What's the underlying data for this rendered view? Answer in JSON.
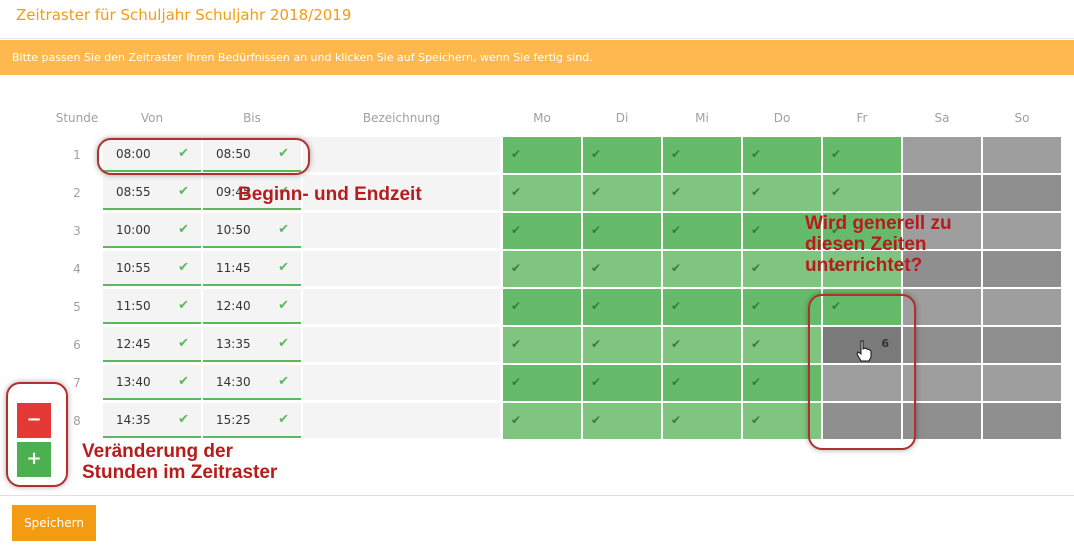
{
  "header": {
    "title": "Zeitraster für Schuljahr Schuljahr 2018/2019"
  },
  "notice": {
    "text": "Bitte passen Sie den Zeitraster Ihren Bedürfnissen an und klicken Sie auf Speichern, wenn Sie fertig sind."
  },
  "table": {
    "columns": {
      "stunde": "Stunde",
      "von": "Von",
      "bis": "Bis",
      "bezeichnung": "Bezeichnung"
    },
    "days": [
      "Mo",
      "Di",
      "Mi",
      "Do",
      "Fr",
      "Sa",
      "So"
    ],
    "rows": [
      {
        "num": "1",
        "von": "08:00",
        "bis": "08:50",
        "active": [
          true,
          true,
          true,
          true,
          true,
          false,
          false
        ]
      },
      {
        "num": "2",
        "von": "08:55",
        "bis": "09:45",
        "active": [
          true,
          true,
          true,
          true,
          true,
          false,
          false
        ]
      },
      {
        "num": "3",
        "von": "10:00",
        "bis": "10:50",
        "active": [
          true,
          true,
          true,
          true,
          true,
          false,
          false
        ]
      },
      {
        "num": "4",
        "von": "10:55",
        "bis": "11:45",
        "active": [
          true,
          true,
          true,
          true,
          true,
          false,
          false
        ]
      },
      {
        "num": "5",
        "von": "11:50",
        "bis": "12:40",
        "active": [
          true,
          true,
          true,
          true,
          true,
          false,
          false
        ]
      },
      {
        "num": "6",
        "von": "12:45",
        "bis": "13:35",
        "active": [
          true,
          true,
          true,
          true,
          false,
          false,
          false
        ]
      },
      {
        "num": "7",
        "von": "13:40",
        "bis": "14:30",
        "active": [
          true,
          true,
          true,
          true,
          false,
          false,
          false
        ]
      },
      {
        "num": "8",
        "von": "14:35",
        "bis": "15:25",
        "active": [
          true,
          true,
          true,
          true,
          false,
          false,
          false
        ]
      }
    ],
    "hover_count": "6"
  },
  "annotations": {
    "times": "Beginn- und Endzeit",
    "schedule_line1": "Wird generell zu",
    "schedule_line2": "diesen Zeiten",
    "schedule_line3": "unterrichtet?",
    "hours_line1": "Veränderung der",
    "hours_line2": "Stunden im Zeitraster"
  },
  "buttons": {
    "remove": "−",
    "add": "+",
    "save": "Speichern"
  },
  "icons": {
    "check": "✔"
  },
  "colors": {
    "accent": "#f39c12",
    "notice": "#ffb84d",
    "active": "#7fc57f",
    "inactive": "#8f8f8f",
    "remove": "#e53935",
    "add": "#4caf50"
  }
}
